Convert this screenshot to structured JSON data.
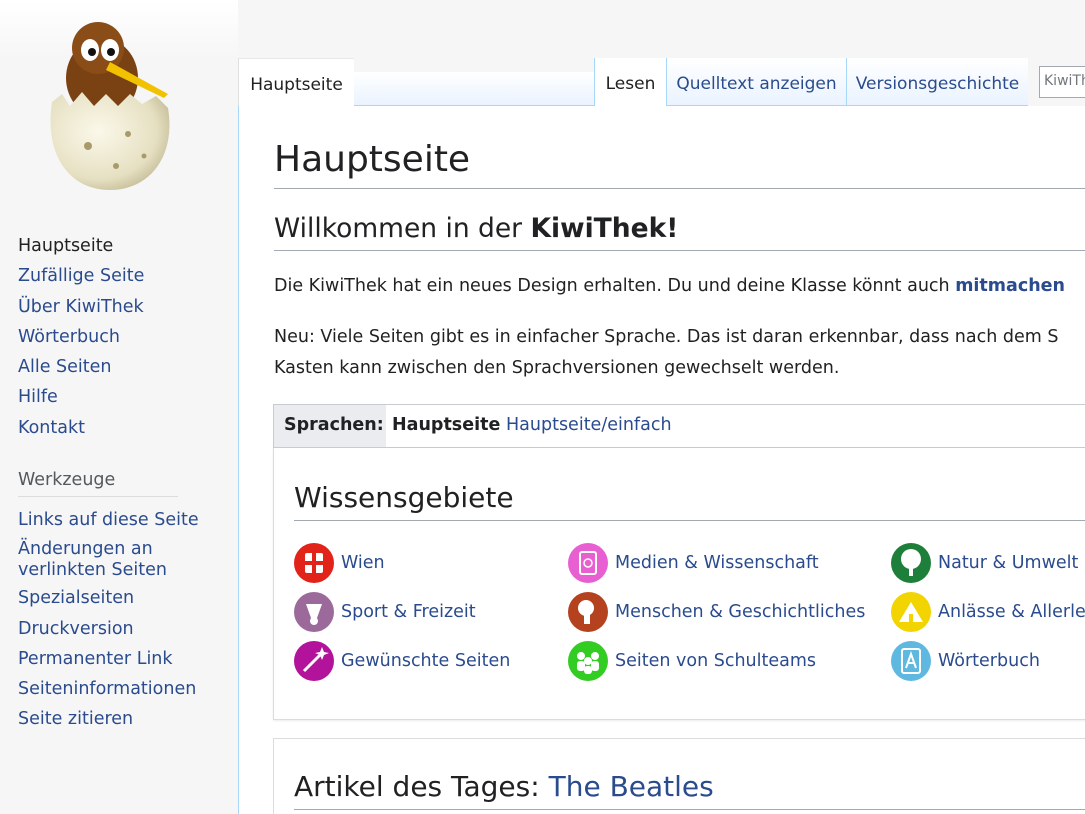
{
  "sidebar": {
    "logo_alt": "KiwiThek",
    "nav": [
      {
        "label": "Hauptseite",
        "active": true
      },
      {
        "label": "Zufällige Seite"
      },
      {
        "label": "Über KiwiThek"
      },
      {
        "label": "Wörterbuch"
      },
      {
        "label": "Alle Seiten"
      },
      {
        "label": "Hilfe"
      },
      {
        "label": "Kontakt"
      }
    ],
    "tools_heading": "Werkzeuge",
    "tools": [
      {
        "label": "Links auf diese Seite"
      },
      {
        "label": "Änderungen an verlinkten Seiten"
      },
      {
        "label": "Spezialseiten"
      },
      {
        "label": "Druckversion"
      },
      {
        "label": "Permanenter Link"
      },
      {
        "label": "Seiteninformationen"
      },
      {
        "label": "Seite zitieren"
      }
    ]
  },
  "tabs": {
    "main": "Hauptseite",
    "read": "Lesen",
    "source": "Quelltext anzeigen",
    "history": "Versionsgeschichte"
  },
  "search": {
    "placeholder": "KiwiThek durchsuchen"
  },
  "content": {
    "title": "Hauptseite",
    "welcome_prefix": "Willkommen in der ",
    "welcome_bold": "KiwiThek!",
    "p1_text": "Die KiwiThek hat ein neues Design erhalten. Du und deine Klasse könnt auch ",
    "p1_link": "mitmachen",
    "p2_line1": "Neu: Viele Seiten gibt es in einfacher Sprache. Das ist daran erkennbar, dass nach dem S",
    "p2_line2": "Kasten kann zwischen den Sprachversionen gewechselt werden.",
    "languages": {
      "label": "Sprachen:",
      "current": "Hauptseite",
      "simple": "Hauptseite/einfach"
    },
    "areas_title": "Wissensgebiete",
    "areas": [
      {
        "label": "Wien",
        "color": "#e2231a",
        "icon": "vienna-icon"
      },
      {
        "label": "Medien & Wissenschaft",
        "color": "#e85fd2",
        "icon": "media-science-icon"
      },
      {
        "label": "Natur & Umwelt",
        "color": "#1e7f3a",
        "icon": "tree-icon"
      },
      {
        "label": "Sport & Freizeit",
        "color": "#9b6a9a",
        "icon": "shuttlecock-icon"
      },
      {
        "label": "Menschen & Geschichtliches",
        "color": "#b5421f",
        "icon": "people-history-icon"
      },
      {
        "label": "Anlässe & Allerlei",
        "color": "#f2d400",
        "icon": "occasions-icon"
      },
      {
        "label": "Gewünschte Seiten",
        "color": "#b3129a",
        "icon": "wish-icon"
      },
      {
        "label": "Seiten von Schulteams",
        "color": "#33cc22",
        "icon": "school-team-icon"
      },
      {
        "label": "Wörterbuch",
        "color": "#5fb8e0",
        "icon": "dictionary-icon"
      }
    ],
    "aotd_prefix": "Artikel des Tages: ",
    "aotd_link": "The Beatles"
  }
}
